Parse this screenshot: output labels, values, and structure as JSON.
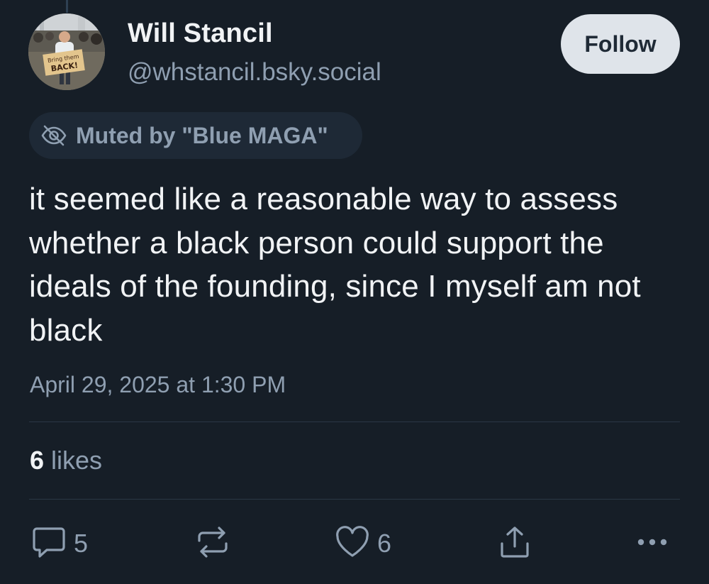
{
  "author": {
    "name": "Will Stancil",
    "handle": "@whstancil.bsky.social",
    "avatar_sign_text": "Bring them BACK!"
  },
  "follow_button": {
    "label": "Follow"
  },
  "moderation": {
    "icon": "eye-slash-icon",
    "label": "Muted by \"Blue MAGA\""
  },
  "post": {
    "text": "it seemed like a reasonable way to assess whether a black person could support the ideals of the founding, since I myself am not black",
    "timestamp": "April 29, 2025 at 1:30 PM"
  },
  "stats": {
    "likes_count": "6",
    "likes_label": " likes"
  },
  "actions": {
    "reply": {
      "icon": "reply-bubble-icon",
      "count": "5"
    },
    "repost": {
      "icon": "repost-arrows-icon"
    },
    "like": {
      "icon": "heart-icon",
      "count": "6"
    },
    "share": {
      "icon": "share-icon"
    },
    "more": {
      "icon": "more-dots-icon"
    }
  },
  "colors": {
    "background": "#161e27",
    "text_primary": "#f1f3f5",
    "text_secondary": "#8f9fb1",
    "follow_bg": "#dfe4ea",
    "pill_bg": "#1e2936",
    "divider": "#2b3745"
  }
}
